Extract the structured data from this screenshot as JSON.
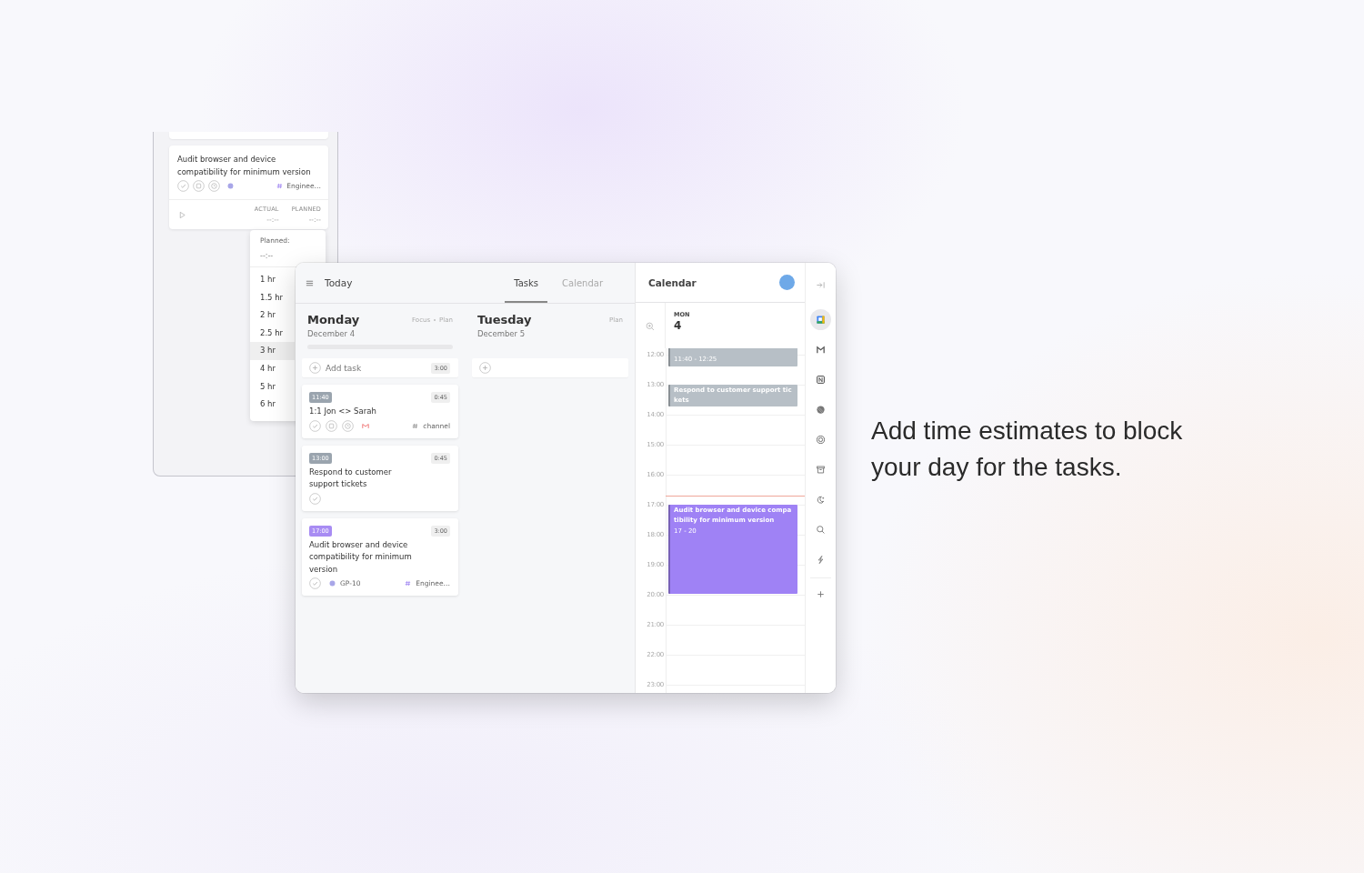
{
  "caption": "Add time estimates to block your day for the tasks.",
  "back_panel": {
    "card": {
      "title": "Audit browser and device compatibility for minimum version",
      "icons": [
        {
          "kind": "check"
        },
        {
          "kind": "calendar"
        },
        {
          "kind": "clock"
        },
        {
          "kind": "issue"
        }
      ],
      "tag": "Enginee…",
      "actual_label": "ACTUAL",
      "actual_value": "--:--",
      "planned_label": "PLANNED",
      "planned_value": "--:--"
    },
    "dropdown": {
      "label": "Planned:",
      "value": "--:--",
      "options": [
        {
          "label": "1 hr",
          "selected": false
        },
        {
          "label": "1.5 hr",
          "selected": false
        },
        {
          "label": "2 hr",
          "selected": false
        },
        {
          "label": "2.5 hr",
          "selected": false
        },
        {
          "label": "3 hr",
          "selected": true
        },
        {
          "label": "4 hr",
          "selected": false
        },
        {
          "label": "5 hr",
          "selected": false
        },
        {
          "label": "6 hr",
          "selected": false
        }
      ]
    }
  },
  "header": {
    "title": "Today",
    "tabs": [
      {
        "label": "Tasks",
        "selected": true
      },
      {
        "label": "Calendar",
        "selected": false
      }
    ]
  },
  "days": [
    {
      "name": "Monday",
      "date": "December 4",
      "actions": [
        "Focus",
        "Plan"
      ],
      "level": 0,
      "add_task": {
        "label": "Add task",
        "duration": "3:00"
      },
      "tasks": [
        {
          "time": "11:40",
          "color": "#9aa4ae",
          "duration": "0:45",
          "title": "1:1 Jon <> Sarah",
          "icons": [
            {
              "kind": "check"
            },
            {
              "kind": "calendar"
            },
            {
              "kind": "clock"
            },
            {
              "kind": "mail"
            }
          ],
          "tag": "channel"
        },
        {
          "time": "13:00",
          "color": "#9aa4ae",
          "duration": "0:45",
          "title": "Respond to customer support tickets",
          "icons": [
            {
              "kind": "check"
            }
          ]
        },
        {
          "time": "17:00",
          "color": "#a88cf3",
          "duration": "3:00",
          "title": "Audit browser and device compatibility for minimum version",
          "icons": [
            {
              "kind": "check"
            },
            {
              "kind": "issue"
            }
          ],
          "issue": "GP-10",
          "tag": "Enginee…"
        }
      ]
    },
    {
      "name": "Tuesday",
      "date": "December 5",
      "actions": [
        "Plan"
      ]
    }
  ],
  "calendar": {
    "title": "Calendar",
    "day_label": "MON",
    "day_number": "4",
    "hours": [
      "12:00",
      "13:00",
      "14:00",
      "15:00",
      "16:00",
      "17:00",
      "18:00",
      "19:00",
      "20:00",
      "21:00",
      "22:00",
      "23:00"
    ],
    "events": [
      {
        "time": "11:40 - 12:25",
        "color": "#b7bfc6"
      },
      {
        "title": "Respond to customer support tickets",
        "color": "#b7bfc6"
      },
      {
        "title": "Audit browser and device compatibility for minimum version",
        "time": "17 - 20",
        "color": "#9f82f5"
      }
    ]
  },
  "rail": [
    {
      "kind": "collapse",
      "selected": false
    },
    {
      "kind": "gcal",
      "selected": true
    },
    {
      "kind": "gmail",
      "selected": false
    },
    {
      "kind": "notion",
      "selected": false
    },
    {
      "kind": "disc",
      "selected": false
    },
    {
      "kind": "target",
      "selected": false
    },
    {
      "kind": "archive",
      "selected": false
    },
    {
      "kind": "moon",
      "selected": false
    },
    {
      "kind": "search",
      "selected": false
    },
    {
      "kind": "bolt",
      "selected": false
    },
    {
      "kind": "plus",
      "selected": false
    }
  ]
}
